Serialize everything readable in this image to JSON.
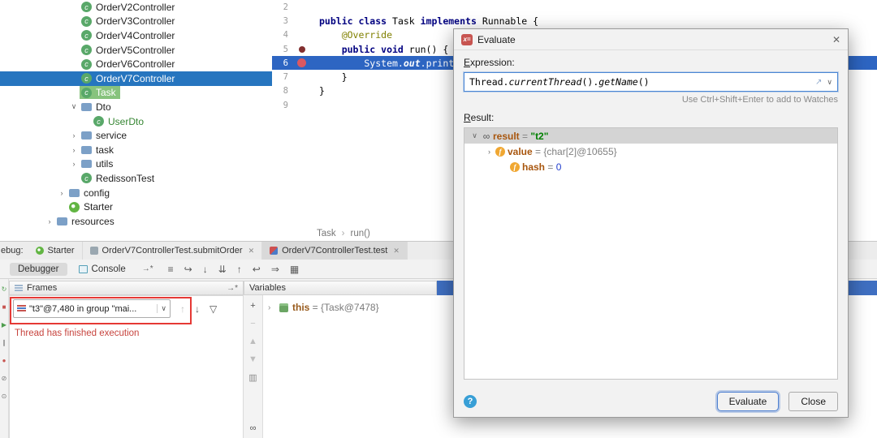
{
  "colors": {
    "tree_selection_blue": "#2675BF",
    "execution_line_blue": "#2D65C2",
    "header_highlight_blue": "#3F6FC1",
    "open_file_green": "#87C37D",
    "error_red": "#C7443E",
    "annotation_red": "#E53935"
  },
  "icon_glyphs": {
    "chevron_down": "∨",
    "chevron_right": "›",
    "class_letter": "c",
    "field_letter": "f",
    "infinity": "∞",
    "close": "✕",
    "help": "?",
    "expand": "↗",
    "up": "↑",
    "down": "↓",
    "filter": "▽",
    "arrow_star": "→*",
    "breadcrumb_sep": "›",
    "evaluate_badge": "x="
  },
  "project_tree": {
    "items": [
      {
        "label": "OrderV2Controller",
        "icon": "class",
        "level": 2
      },
      {
        "label": "OrderV3Controller",
        "icon": "class",
        "level": 2
      },
      {
        "label": "OrderV4Controller",
        "icon": "class",
        "level": 2
      },
      {
        "label": "OrderV5Controller",
        "icon": "class",
        "level": 2
      },
      {
        "label": "OrderV6Controller",
        "icon": "class",
        "level": 2
      },
      {
        "label": "OrderV7Controller",
        "icon": "class",
        "level": 2,
        "selected": true
      },
      {
        "label": "Task",
        "icon": "class",
        "level": 2,
        "highlight": "green"
      },
      {
        "label": "Dto",
        "icon": "folder",
        "level": 2,
        "expanded": true
      },
      {
        "label": "UserDto",
        "icon": "class",
        "level": 3,
        "vcs_new": true
      },
      {
        "label": "service",
        "icon": "folder",
        "level": 2,
        "collapsed": true
      },
      {
        "label": "task",
        "icon": "folder",
        "level": 2,
        "collapsed": true
      },
      {
        "label": "utils",
        "icon": "folder",
        "level": 2,
        "collapsed": true
      },
      {
        "label": "RedissonTest",
        "icon": "class",
        "level": 2
      },
      {
        "label": "config",
        "icon": "folder",
        "level": 1,
        "collapsed": true
      },
      {
        "label": "Starter",
        "icon": "spring",
        "level": 1
      },
      {
        "label": "resources",
        "icon": "folder",
        "level": 0,
        "collapsed": true
      }
    ]
  },
  "editor": {
    "breadcrumb": [
      "Task",
      "run()"
    ],
    "lines": [
      {
        "num": 2,
        "tokens": []
      },
      {
        "num": 3,
        "tokens": [
          {
            "k": "kw",
            "t": "public class "
          },
          {
            "k": "p",
            "t": "Task "
          },
          {
            "k": "kw",
            "t": "implements "
          },
          {
            "k": "p",
            "t": "Runnable {"
          }
        ]
      },
      {
        "num": 4,
        "tokens": [
          {
            "k": "ann",
            "t": "    @Override"
          }
        ]
      },
      {
        "num": 5,
        "gutter": "method-dot",
        "tokens": [
          {
            "k": "kw",
            "t": "    public void "
          },
          {
            "k": "p",
            "t": "run() {"
          }
        ]
      },
      {
        "num": 6,
        "gutter": "breakpoint",
        "current": true,
        "tokens": [
          {
            "k": "p",
            "t": "        System."
          },
          {
            "k": "field",
            "t": "out"
          },
          {
            "k": "p",
            "t": ".println("
          },
          {
            "k": "str",
            "t": "\"="
          }
        ]
      },
      {
        "num": 7,
        "tokens": [
          {
            "k": "p",
            "t": "    }"
          }
        ]
      },
      {
        "num": 8,
        "tokens": [
          {
            "k": "p",
            "t": "}"
          }
        ]
      },
      {
        "num": 9,
        "tokens": []
      }
    ]
  },
  "evaluate_dialog": {
    "title": "Evaluate",
    "expression_label": "Expression:",
    "expression": "Thread.currentThread().getName()",
    "expression_tokens": [
      {
        "t": "Thread."
      },
      {
        "t": "currentThread",
        "i": true
      },
      {
        "t": "()."
      },
      {
        "t": "getName",
        "i": true
      },
      {
        "t": "()"
      }
    ],
    "hint": "Use Ctrl+Shift+Enter to add to Watches",
    "result_label": "Result:",
    "result_rows": [
      {
        "expander": "down",
        "icon": "result",
        "name": "result",
        "eq": " = ",
        "value": "\"t2\"",
        "value_kind": "string",
        "selected": true,
        "indent": 0
      },
      {
        "expander": "right",
        "icon": "field",
        "name": "value",
        "eq": " = ",
        "value": "{char[2]@10655}",
        "value_kind": "ref",
        "indent": 1
      },
      {
        "expander": "none",
        "icon": "field",
        "name": "hash",
        "eq": " = ",
        "value": "0",
        "value_kind": "number",
        "indent": 2
      }
    ],
    "evaluate_button": "Evaluate",
    "close_button": "Close"
  },
  "debug_panel": {
    "window_label": "ebug:",
    "session_tabs": [
      {
        "label": "Starter",
        "icon": "spring"
      },
      {
        "label": "OrderV7ControllerTest.submitOrder",
        "icon": "test",
        "closable": true
      },
      {
        "label": "OrderV7ControllerTest.test",
        "icon": "test-red",
        "closable": true,
        "selected": true
      }
    ],
    "view_tabs": [
      {
        "label": "Debugger",
        "selected": true
      },
      {
        "label": "Console",
        "icon": "console"
      }
    ],
    "toolbar_icons": [
      {
        "name": "show-execution-point",
        "glyph": "≡"
      },
      {
        "name": "step-over",
        "glyph": "↪"
      },
      {
        "name": "step-into",
        "glyph": "↓"
      },
      {
        "name": "force-step-into",
        "glyph": "⇊"
      },
      {
        "name": "step-out",
        "glyph": "↑"
      },
      {
        "name": "drop-frame",
        "glyph": "↩"
      },
      {
        "name": "run-to-cursor",
        "glyph": "⇒"
      },
      {
        "name": "view-breakpoints-grid",
        "glyph": "▦"
      }
    ],
    "left_toolbar": [
      {
        "name": "rerun",
        "glyph": "↻",
        "color": "#4F9E4F"
      },
      {
        "name": "stop",
        "glyph": "■",
        "color": "#C75450"
      },
      {
        "name": "resume",
        "glyph": "▶",
        "color": "#4F9E4F"
      },
      {
        "name": "pause",
        "glyph": "∥",
        "color": "#777777"
      },
      {
        "name": "view-breakpoints",
        "glyph": "●",
        "color": "#C75450"
      },
      {
        "name": "mute-breakpoints",
        "glyph": "⊘",
        "color": "#777777"
      },
      {
        "name": "settings",
        "glyph": "⊙",
        "color": "#777777"
      }
    ],
    "frames": {
      "header": "Frames",
      "thread_dropdown": "\"t3\"@7,480 in group \"mai...",
      "message": "Thread has finished execution"
    },
    "variables": {
      "header": "Variables",
      "toolbar": [
        {
          "name": "add-watch",
          "glyph": "+",
          "color": "#555555"
        },
        {
          "name": "remove-watch",
          "glyph": "−",
          "color": "#BDBDBD"
        },
        {
          "name": "move-watch-up",
          "glyph": "▲",
          "color": "#BDBDBD"
        },
        {
          "name": "move-watch-down",
          "glyph": "▼",
          "color": "#BDBDBD"
        },
        {
          "name": "duplicate-watch",
          "glyph": "▥",
          "color": "#8A8A8A"
        },
        {
          "name": "evaluate-watches",
          "glyph": "∞",
          "color": "#555555",
          "bottom": true
        }
      ],
      "rows": [
        {
          "name": "this",
          "eq": " = ",
          "value": "{Task@7478}"
        }
      ]
    }
  }
}
